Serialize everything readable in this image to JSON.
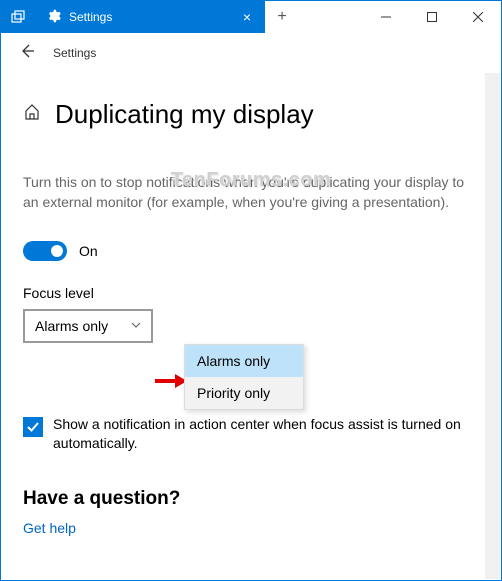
{
  "titlebar": {
    "tab_label": "Settings",
    "new_tab": "+"
  },
  "subheader": {
    "title": "Settings"
  },
  "page": {
    "title": "Duplicating my display",
    "description": "Turn this on to stop notifications when you're duplicating your display to an external monitor (for example, when you're giving a presentation)."
  },
  "toggle": {
    "label": "On"
  },
  "focus": {
    "label": "Focus level",
    "selected": "Alarms only",
    "options": [
      "Alarms only",
      "Priority only"
    ]
  },
  "checkbox": {
    "label": "Show a notification in action center when focus assist is turned on automatically."
  },
  "question": {
    "heading": "Have a question?",
    "link": "Get help"
  },
  "watermark": "TenForums.com"
}
